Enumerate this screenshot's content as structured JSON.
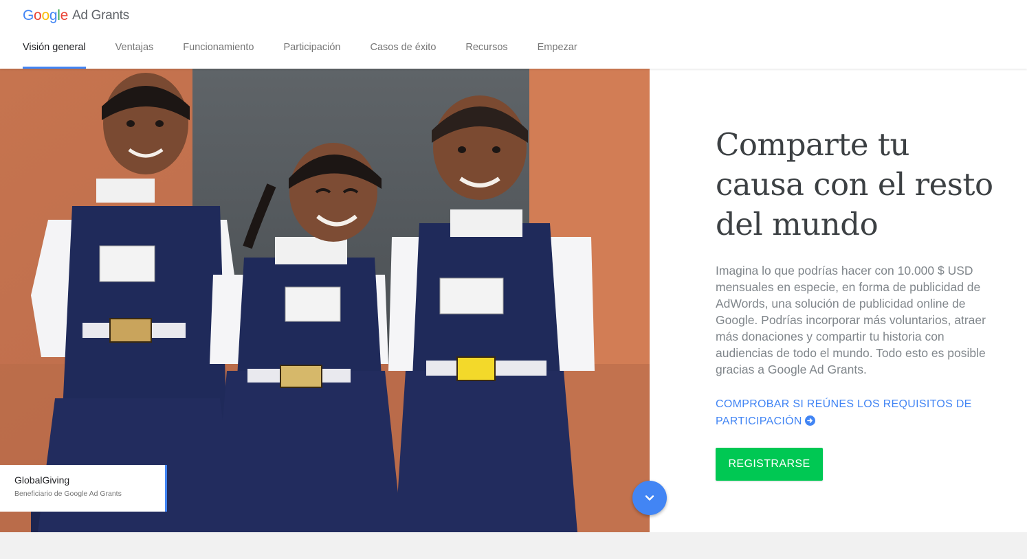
{
  "header": {
    "logo": {
      "letters": [
        "G",
        "o",
        "o",
        "g",
        "l",
        "e"
      ],
      "letter_colors": [
        "#4285f4",
        "#ea4335",
        "#fbbc05",
        "#4285f4",
        "#34a853",
        "#ea4335"
      ],
      "product": "Ad Grants"
    },
    "nav": [
      {
        "label": "Visión general",
        "active": true
      },
      {
        "label": "Ventajas",
        "active": false
      },
      {
        "label": "Funcionamiento",
        "active": false
      },
      {
        "label": "Participación",
        "active": false
      },
      {
        "label": "Casos de éxito",
        "active": false
      },
      {
        "label": "Recursos",
        "active": false
      },
      {
        "label": "Empezar",
        "active": false
      }
    ]
  },
  "hero": {
    "image_subject": "three smiling schoolgirls in navy uniforms",
    "caption": {
      "title": "GlobalGiving",
      "subtitle": "Beneficiario de Google Ad Grants"
    },
    "scroll_icon": "chevron-down-icon"
  },
  "content": {
    "headline": "Comparte tu causa con el resto del mundo",
    "body": "Imagina lo que podrías hacer con 10.000 $ USD mensuales en especie, en forma de publicidad de AdWords, una solución de publicidad online de Google. Podrías incorporar más voluntarios, atraer más donaciones y compartir tu historia con audiencias de todo el mundo. Todo esto es posible gracias a Google Ad Grants.",
    "eligibility_link": "COMPROBAR SI REÚNES LOS REQUISITOS DE PARTICIPACIÓN",
    "eligibility_icon": "arrow-right-circle-icon",
    "register_button": "REGISTRARSE"
  },
  "colors": {
    "accent_blue": "#4285f4",
    "register_green": "#00c853",
    "headline": "#3c4043",
    "body": "#80868b"
  }
}
